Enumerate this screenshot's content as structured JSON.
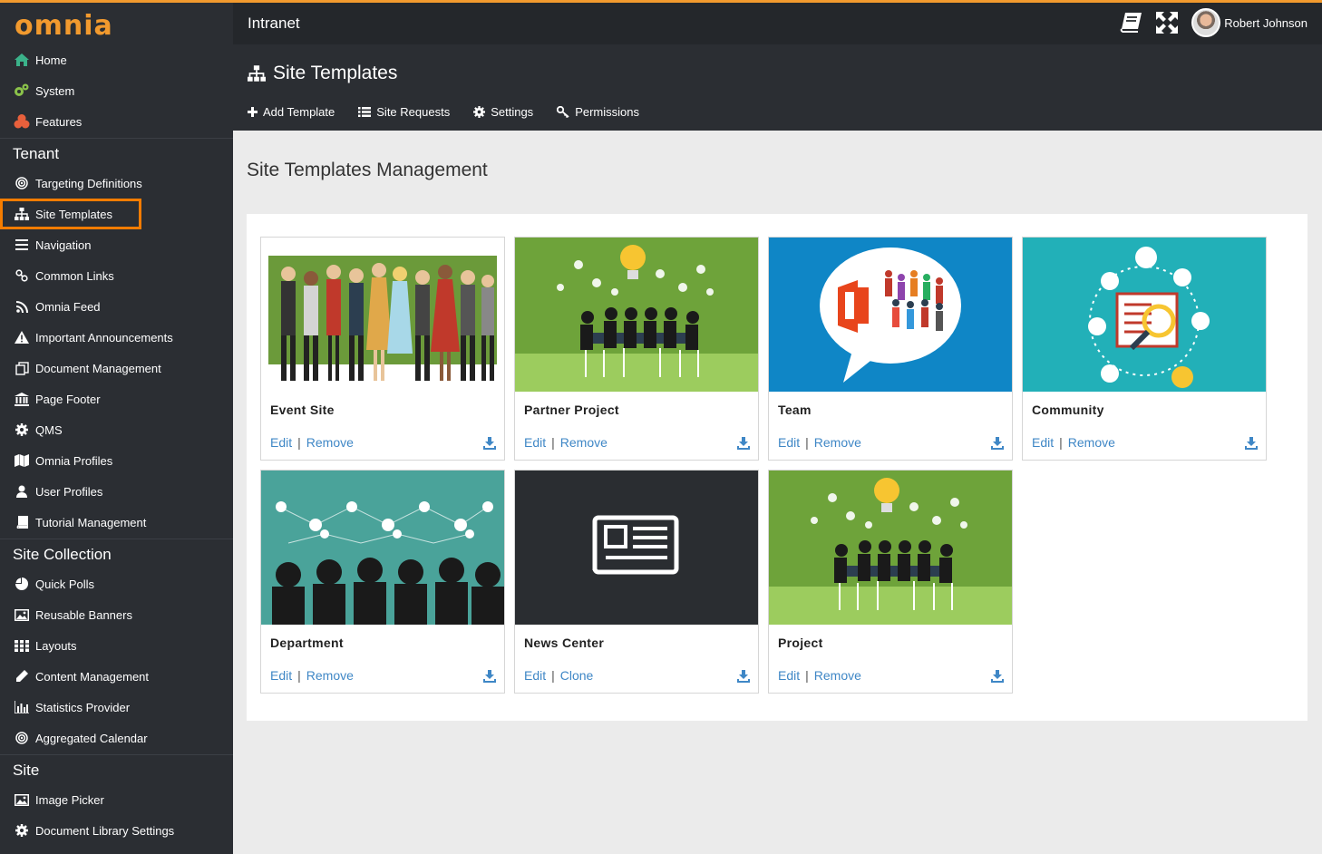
{
  "app": {
    "logo": "omnia",
    "brand": "Intranet",
    "user_name": "Robert Johnson"
  },
  "sidebar": {
    "top_items": [
      {
        "label": "Home",
        "icon": "home-icon"
      },
      {
        "label": "System",
        "icon": "cogs-icon"
      },
      {
        "label": "Features",
        "icon": "puzzle-icon"
      }
    ],
    "tenant_title": "Tenant",
    "tenant_items": [
      {
        "label": "Targeting Definitions",
        "icon": "target-icon"
      },
      {
        "label": "Site Templates",
        "icon": "sitemap-icon",
        "active": true
      },
      {
        "label": "Navigation",
        "icon": "bars-icon"
      },
      {
        "label": "Common Links",
        "icon": "link-icon"
      },
      {
        "label": "Omnia Feed",
        "icon": "rss-icon"
      },
      {
        "label": "Important Announcements",
        "icon": "warning-icon"
      },
      {
        "label": "Document Management",
        "icon": "documents-icon"
      },
      {
        "label": "Page Footer",
        "icon": "bank-icon"
      },
      {
        "label": "QMS",
        "icon": "gear-icon"
      },
      {
        "label": "Omnia Profiles",
        "icon": "map-icon"
      },
      {
        "label": "User Profiles",
        "icon": "user-icon"
      },
      {
        "label": "Tutorial Management",
        "icon": "book-icon"
      }
    ],
    "site_collection_title": "Site Collection",
    "site_collection_items": [
      {
        "label": "Quick Polls",
        "icon": "pie-chart-icon"
      },
      {
        "label": "Reusable Banners",
        "icon": "image-icon"
      },
      {
        "label": "Layouts",
        "icon": "grid-icon"
      },
      {
        "label": "Content Management",
        "icon": "pencil-icon"
      },
      {
        "label": "Statistics Provider",
        "icon": "bar-chart-icon"
      },
      {
        "label": "Aggregated Calendar",
        "icon": "target-icon"
      }
    ],
    "site_title": "Site",
    "site_items": [
      {
        "label": "Image Picker",
        "icon": "image-icon"
      },
      {
        "label": "Document Library Settings",
        "icon": "gear-icon"
      }
    ]
  },
  "header": {
    "title": "Site Templates",
    "toolbar": [
      {
        "label": "Add Template",
        "icon": "plus-icon"
      },
      {
        "label": "Site Requests",
        "icon": "list-icon"
      },
      {
        "label": "Settings",
        "icon": "gear-icon"
      },
      {
        "label": "Permissions",
        "icon": "key-icon"
      }
    ]
  },
  "main": {
    "title": "Site Templates Management",
    "templates": [
      {
        "name": "Event Site",
        "action1": "Edit",
        "action2": "Remove",
        "theme": "party"
      },
      {
        "name": "Partner Project",
        "action1": "Edit",
        "action2": "Remove",
        "theme": "meeting"
      },
      {
        "name": "Team",
        "action1": "Edit",
        "action2": "Remove",
        "theme": "team"
      },
      {
        "name": "Community",
        "action1": "Edit",
        "action2": "Remove",
        "theme": "community"
      },
      {
        "name": "Department",
        "action1": "Edit",
        "action2": "Remove",
        "theme": "department"
      },
      {
        "name": "News Center",
        "action1": "Edit",
        "action2": "Clone",
        "theme": "news"
      },
      {
        "name": "Project",
        "action1": "Edit",
        "action2": "Remove",
        "theme": "meeting"
      }
    ]
  },
  "colors": {
    "accent": "#f29a2e",
    "link": "#3f87c6",
    "sidebar": "#2b2e33",
    "active_outline": "#f57c00"
  }
}
